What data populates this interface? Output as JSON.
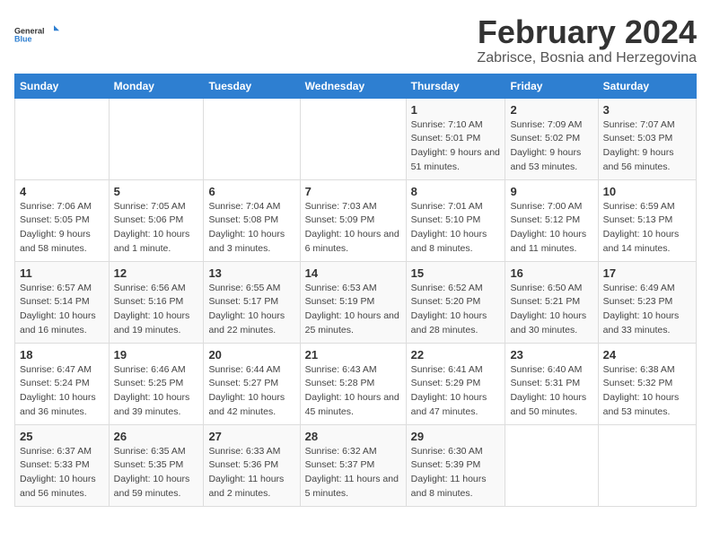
{
  "logo": {
    "general": "General",
    "blue": "Blue"
  },
  "title": "February 2024",
  "subtitle": "Zabrisce, Bosnia and Herzegovina",
  "days_of_week": [
    "Sunday",
    "Monday",
    "Tuesday",
    "Wednesday",
    "Thursday",
    "Friday",
    "Saturday"
  ],
  "weeks": [
    [
      {
        "day": "",
        "info": ""
      },
      {
        "day": "",
        "info": ""
      },
      {
        "day": "",
        "info": ""
      },
      {
        "day": "",
        "info": ""
      },
      {
        "day": "1",
        "info": "Sunrise: 7:10 AM\nSunset: 5:01 PM\nDaylight: 9 hours and 51 minutes."
      },
      {
        "day": "2",
        "info": "Sunrise: 7:09 AM\nSunset: 5:02 PM\nDaylight: 9 hours and 53 minutes."
      },
      {
        "day": "3",
        "info": "Sunrise: 7:07 AM\nSunset: 5:03 PM\nDaylight: 9 hours and 56 minutes."
      }
    ],
    [
      {
        "day": "4",
        "info": "Sunrise: 7:06 AM\nSunset: 5:05 PM\nDaylight: 9 hours and 58 minutes."
      },
      {
        "day": "5",
        "info": "Sunrise: 7:05 AM\nSunset: 5:06 PM\nDaylight: 10 hours and 1 minute."
      },
      {
        "day": "6",
        "info": "Sunrise: 7:04 AM\nSunset: 5:08 PM\nDaylight: 10 hours and 3 minutes."
      },
      {
        "day": "7",
        "info": "Sunrise: 7:03 AM\nSunset: 5:09 PM\nDaylight: 10 hours and 6 minutes."
      },
      {
        "day": "8",
        "info": "Sunrise: 7:01 AM\nSunset: 5:10 PM\nDaylight: 10 hours and 8 minutes."
      },
      {
        "day": "9",
        "info": "Sunrise: 7:00 AM\nSunset: 5:12 PM\nDaylight: 10 hours and 11 minutes."
      },
      {
        "day": "10",
        "info": "Sunrise: 6:59 AM\nSunset: 5:13 PM\nDaylight: 10 hours and 14 minutes."
      }
    ],
    [
      {
        "day": "11",
        "info": "Sunrise: 6:57 AM\nSunset: 5:14 PM\nDaylight: 10 hours and 16 minutes."
      },
      {
        "day": "12",
        "info": "Sunrise: 6:56 AM\nSunset: 5:16 PM\nDaylight: 10 hours and 19 minutes."
      },
      {
        "day": "13",
        "info": "Sunrise: 6:55 AM\nSunset: 5:17 PM\nDaylight: 10 hours and 22 minutes."
      },
      {
        "day": "14",
        "info": "Sunrise: 6:53 AM\nSunset: 5:19 PM\nDaylight: 10 hours and 25 minutes."
      },
      {
        "day": "15",
        "info": "Sunrise: 6:52 AM\nSunset: 5:20 PM\nDaylight: 10 hours and 28 minutes."
      },
      {
        "day": "16",
        "info": "Sunrise: 6:50 AM\nSunset: 5:21 PM\nDaylight: 10 hours and 30 minutes."
      },
      {
        "day": "17",
        "info": "Sunrise: 6:49 AM\nSunset: 5:23 PM\nDaylight: 10 hours and 33 minutes."
      }
    ],
    [
      {
        "day": "18",
        "info": "Sunrise: 6:47 AM\nSunset: 5:24 PM\nDaylight: 10 hours and 36 minutes."
      },
      {
        "day": "19",
        "info": "Sunrise: 6:46 AM\nSunset: 5:25 PM\nDaylight: 10 hours and 39 minutes."
      },
      {
        "day": "20",
        "info": "Sunrise: 6:44 AM\nSunset: 5:27 PM\nDaylight: 10 hours and 42 minutes."
      },
      {
        "day": "21",
        "info": "Sunrise: 6:43 AM\nSunset: 5:28 PM\nDaylight: 10 hours and 45 minutes."
      },
      {
        "day": "22",
        "info": "Sunrise: 6:41 AM\nSunset: 5:29 PM\nDaylight: 10 hours and 47 minutes."
      },
      {
        "day": "23",
        "info": "Sunrise: 6:40 AM\nSunset: 5:31 PM\nDaylight: 10 hours and 50 minutes."
      },
      {
        "day": "24",
        "info": "Sunrise: 6:38 AM\nSunset: 5:32 PM\nDaylight: 10 hours and 53 minutes."
      }
    ],
    [
      {
        "day": "25",
        "info": "Sunrise: 6:37 AM\nSunset: 5:33 PM\nDaylight: 10 hours and 56 minutes."
      },
      {
        "day": "26",
        "info": "Sunrise: 6:35 AM\nSunset: 5:35 PM\nDaylight: 10 hours and 59 minutes."
      },
      {
        "day": "27",
        "info": "Sunrise: 6:33 AM\nSunset: 5:36 PM\nDaylight: 11 hours and 2 minutes."
      },
      {
        "day": "28",
        "info": "Sunrise: 6:32 AM\nSunset: 5:37 PM\nDaylight: 11 hours and 5 minutes."
      },
      {
        "day": "29",
        "info": "Sunrise: 6:30 AM\nSunset: 5:39 PM\nDaylight: 11 hours and 8 minutes."
      },
      {
        "day": "",
        "info": ""
      },
      {
        "day": "",
        "info": ""
      }
    ]
  ]
}
